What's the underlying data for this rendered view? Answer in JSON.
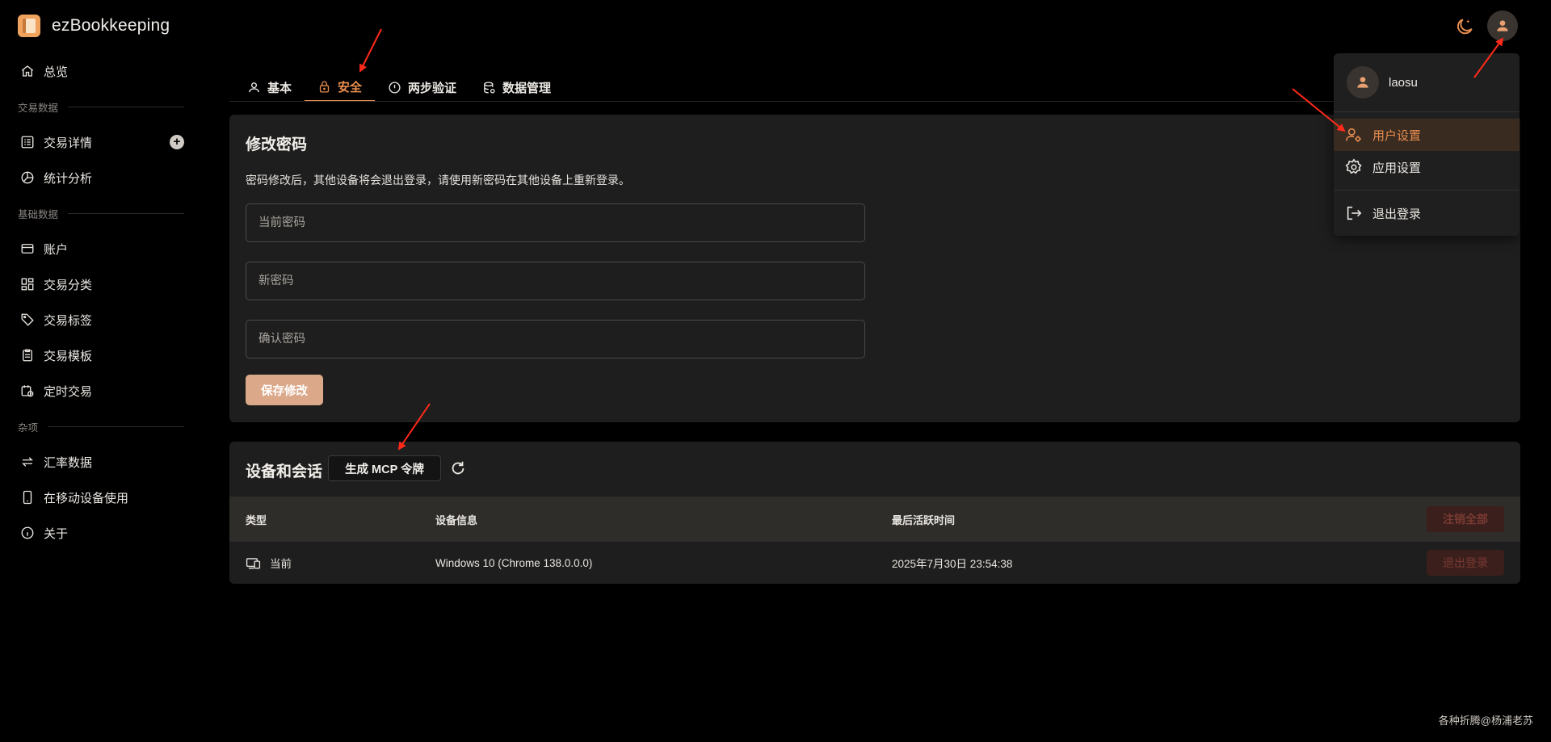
{
  "app": {
    "title": "ezBookkeeping"
  },
  "sidebar": {
    "overview": "总览",
    "sections": {
      "transactions": "交易数据",
      "basic": "基础数据",
      "misc": "杂项"
    },
    "items": [
      {
        "label": "交易详情",
        "icon": "list-icon"
      },
      {
        "label": "统计分析",
        "icon": "pie-chart-icon"
      },
      {
        "label": "账户",
        "icon": "credit-card-icon"
      },
      {
        "label": "交易分类",
        "icon": "grid-icon"
      },
      {
        "label": "交易标签",
        "icon": "tag-icon"
      },
      {
        "label": "交易模板",
        "icon": "clipboard-icon"
      },
      {
        "label": "定时交易",
        "icon": "calendar-clock-icon"
      },
      {
        "label": "汇率数据",
        "icon": "exchange-icon"
      },
      {
        "label": "在移动设备使用",
        "icon": "phone-icon"
      },
      {
        "label": "关于",
        "icon": "info-icon"
      }
    ]
  },
  "tabs": [
    {
      "label": "基本",
      "icon": "user-icon"
    },
    {
      "label": "安全",
      "icon": "lock-icon",
      "active": true
    },
    {
      "label": "两步验证",
      "icon": "alert-circle-icon"
    },
    {
      "label": "数据管理",
      "icon": "database-icon"
    }
  ],
  "password": {
    "title": "修改密码",
    "description": "密码修改后，其他设备将会退出登录，请使用新密码在其他设备上重新登录。",
    "current_placeholder": "当前密码",
    "new_placeholder": "新密码",
    "confirm_placeholder": "确认密码",
    "save_label": "保存修改"
  },
  "devices": {
    "title": "设备和会话",
    "mcp_button": "生成 MCP 令牌",
    "columns": {
      "type": "类型",
      "info": "设备信息",
      "last_active": "最后活跃时间"
    },
    "revoke_all": "注销全部",
    "rows": [
      {
        "type": "当前",
        "info": "Windows 10 (Chrome 138.0.0.0)",
        "last_active": "2025年7月30日 23:54:38",
        "action": "退出登录"
      }
    ]
  },
  "user_menu": {
    "username": "laosu",
    "items": {
      "user_settings": "用户设置",
      "app_settings": "应用设置",
      "logout": "退出登录"
    }
  },
  "watermark": "各种折腾@杨浦老苏",
  "colors": {
    "accent": "#e88d4f",
    "background": "#000000",
    "card": "#1e1e1e",
    "annotation": "#ff2a1a"
  }
}
